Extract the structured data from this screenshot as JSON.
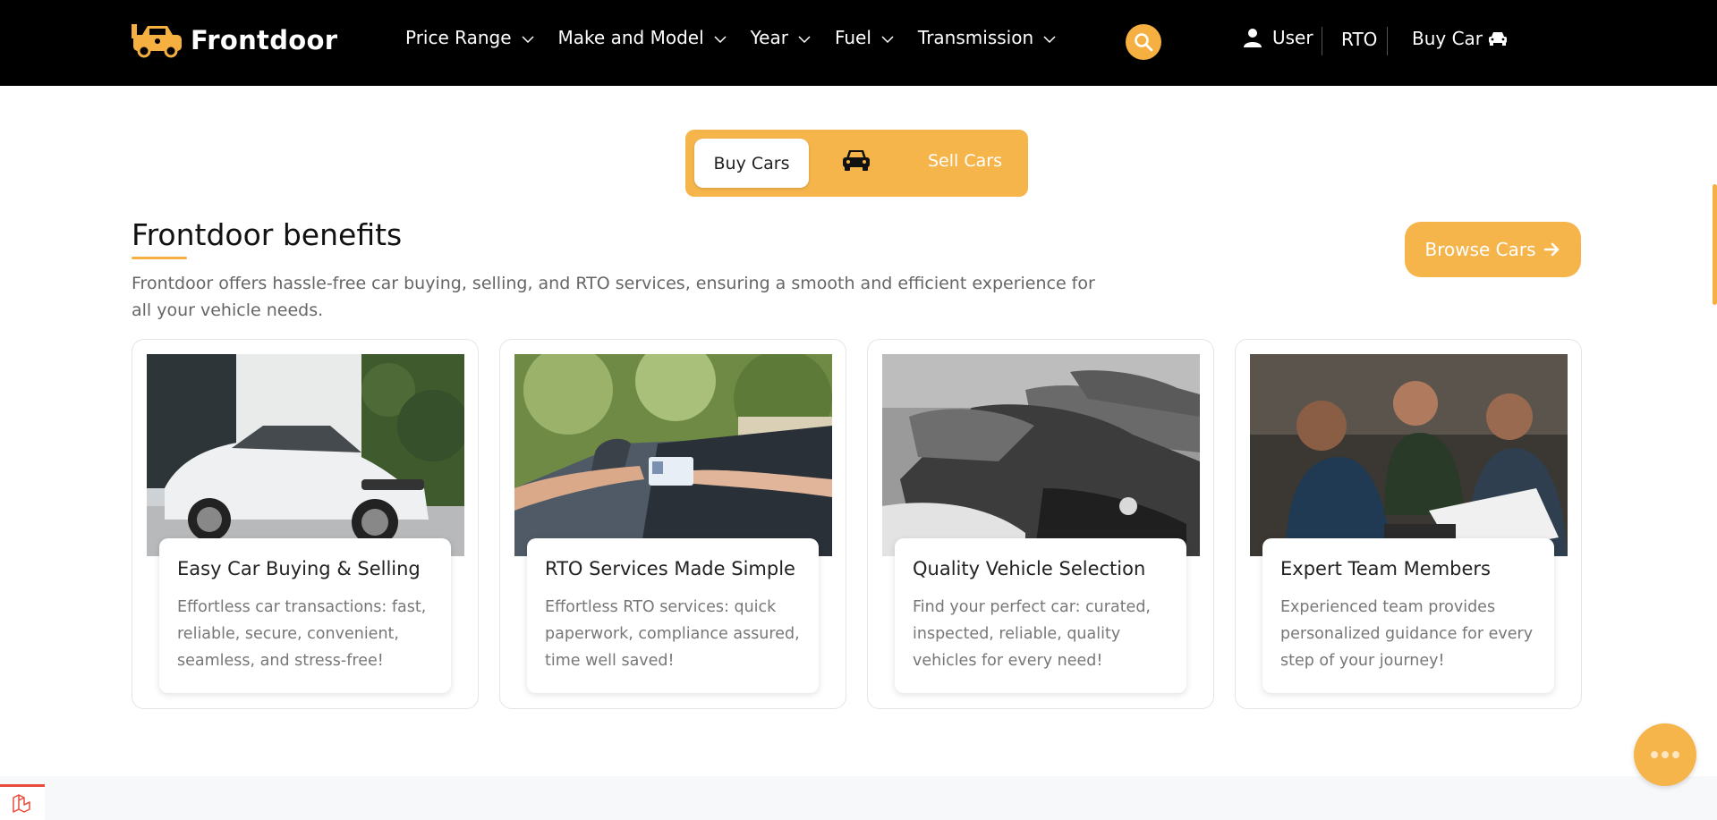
{
  "header": {
    "brand": "Frontdoor",
    "nav": [
      "Price Range",
      "Make and Model",
      "Year",
      "Fuel",
      "Transmission"
    ],
    "user_label": "User",
    "rto_label": "RTO",
    "buy_car_label": "Buy Car"
  },
  "toggle": {
    "buy_label": "Buy Cars",
    "sell_label": "Sell Cars"
  },
  "benefits": {
    "title": "Frontdoor benefits",
    "description": "Frontdoor offers hassle-free car buying, selling, and RTO services, ensuring a smooth and efficient experience for all your vehicle needs.",
    "browse_label": "Browse Cars"
  },
  "cards": [
    {
      "title": "Easy Car Buying & Selling",
      "text": "Effortless car transactions: fast, reliable, secure, convenient, seamless, and stress-free!"
    },
    {
      "title": "RTO Services Made Simple",
      "text": "Effortless RTO services: quick paperwork, compliance assured, time well saved!"
    },
    {
      "title": "Quality Vehicle Selection",
      "text": "Find your perfect car: curated, inspected, reliable, quality vehicles for every need!"
    },
    {
      "title": "Expert Team Members",
      "text": "Experienced team provides personalized guidance for every step of your journey!"
    }
  ],
  "colors": {
    "accent": "#f5b041",
    "header_bg": "#000000"
  }
}
